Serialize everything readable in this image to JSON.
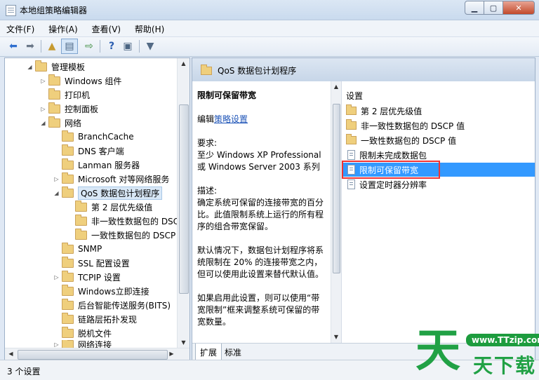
{
  "window": {
    "title": "本地组策略编辑器"
  },
  "menu": [
    "文件(F)",
    "操作(A)",
    "查看(V)",
    "帮助(H)"
  ],
  "toolbar": {
    "icons": [
      "back-arrow",
      "forward-arrow",
      "up-folder",
      "show-hide-tree",
      "export-list",
      "help",
      "properties",
      "filter"
    ]
  },
  "tree": [
    {
      "label": "管理模板",
      "arrow": "◢"
    },
    {
      "label": "Windows 组件",
      "arrow": "▷"
    },
    {
      "label": "打印机",
      "arrow": ""
    },
    {
      "label": "控制面板",
      "arrow": "▷"
    },
    {
      "label": "网络",
      "arrow": "◢"
    },
    {
      "label": "BranchCache",
      "arrow": ""
    },
    {
      "label": "DNS 客户端",
      "arrow": ""
    },
    {
      "label": "Lanman 服务器",
      "arrow": ""
    },
    {
      "label": "Microsoft 对等网络服务",
      "arrow": "▷"
    },
    {
      "label": "QoS 数据包计划程序",
      "arrow": "◢"
    },
    {
      "label": "第 2 层优先级值",
      "arrow": ""
    },
    {
      "label": "非一致性数据包的 DSCP",
      "arrow": ""
    },
    {
      "label": "一致性数据包的 DSCP",
      "arrow": ""
    },
    {
      "label": "SNMP",
      "arrow": ""
    },
    {
      "label": "SSL 配置设置",
      "arrow": ""
    },
    {
      "label": "TCPIP 设置",
      "arrow": "▷"
    },
    {
      "label": "Windows立即连接",
      "arrow": ""
    },
    {
      "label": "后台智能传送服务(BITS)",
      "arrow": ""
    },
    {
      "label": "链路层拓扑发现",
      "arrow": ""
    },
    {
      "label": "脱机文件",
      "arrow": ""
    },
    {
      "label": "网络连接",
      "arrow": "▷"
    }
  ],
  "right": {
    "header": "QoS 数据包计划程序",
    "desc": {
      "title": "限制可保留带宽",
      "edit_prefix": "编辑",
      "edit_link": "策略设置",
      "req_label": "要求:",
      "req_text": "至少 Windows XP Professional 或 Windows Server 2003 系列",
      "desc_label": "描述:",
      "desc_p1": "确定系统可保留的连接带宽的百分比。此值限制系统上运行的所有程序的组合带宽保留。",
      "desc_p2": "默认情况下，数据包计划程序将系统限制在 20% 的连接带宽之内，但可以使用此设置来替代默认值。",
      "desc_p3": "如果启用此设置，则可以使用“带宽限制”框来调整系统可保留的带宽数量。"
    },
    "settings_header": "设置",
    "settings": [
      {
        "label": "第 2 层优先级值",
        "type": "folder"
      },
      {
        "label": "非一致性数据包的 DSCP 值",
        "type": "folder"
      },
      {
        "label": "一致性数据包的 DSCP 值",
        "type": "folder"
      },
      {
        "label": "限制未完成数据包",
        "type": "policy"
      },
      {
        "label": "限制可保留带宽",
        "type": "policy"
      },
      {
        "label": "设置定时器分辨率",
        "type": "policy"
      }
    ],
    "tabs": [
      "扩展",
      "标准"
    ]
  },
  "status": "3 个设置",
  "watermark": {
    "url": "www.TTzip.com",
    "big": "天",
    "small": "天下载"
  }
}
